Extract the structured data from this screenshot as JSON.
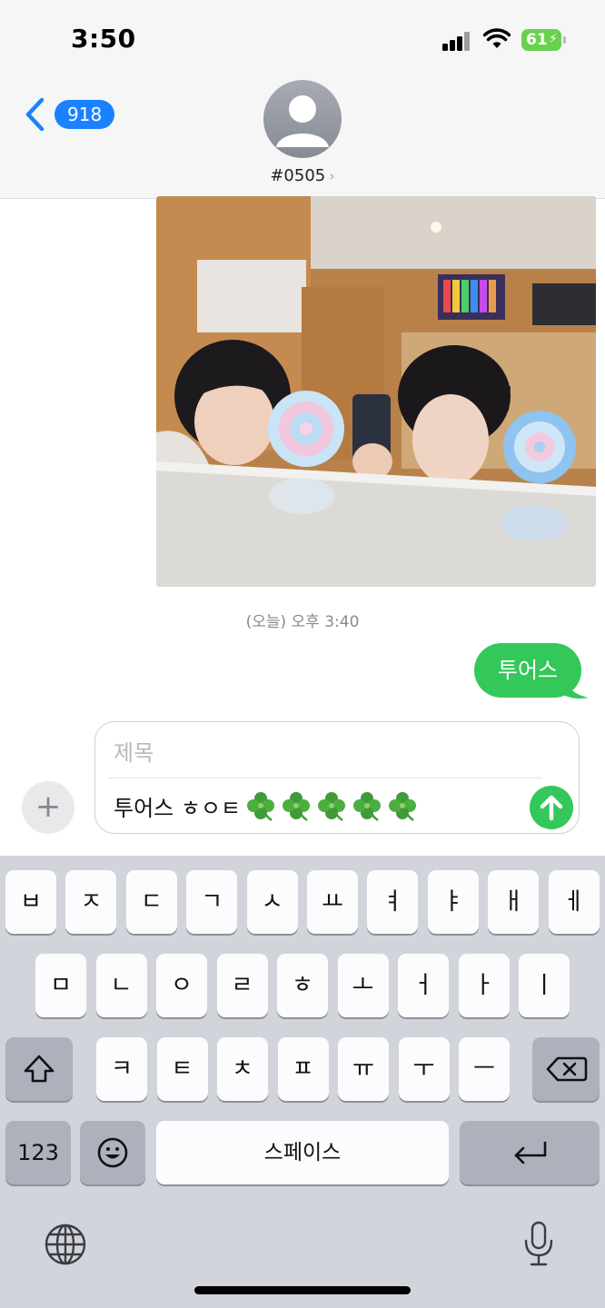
{
  "status_bar": {
    "time": "3:50",
    "battery": "61"
  },
  "header": {
    "back_count": "918",
    "contact_name": "#0505",
    "chevron": "›"
  },
  "conversation": {
    "timestamp": "(오늘) 오후 3:40",
    "sent_message": "투어스"
  },
  "compose": {
    "plus_label": "+",
    "subject_placeholder": "제목",
    "body_text": "투어스 ㅎㅇㅌ",
    "clover_count": 5
  },
  "keyboard": {
    "row1": [
      "ㅂ",
      "ㅈ",
      "ㄷ",
      "ㄱ",
      "ㅅ",
      "ㅛ",
      "ㅕ",
      "ㅑ",
      "ㅐ",
      "ㅔ"
    ],
    "row2": [
      "ㅁ",
      "ㄴ",
      "ㅇ",
      "ㄹ",
      "ㅎ",
      "ㅗ",
      "ㅓ",
      "ㅏ",
      "ㅣ"
    ],
    "row3": [
      "ㅋ",
      "ㅌ",
      "ㅊ",
      "ㅍ",
      "ㅠ",
      "ㅜ",
      "ㅡ"
    ],
    "numbers_label": "123",
    "space_label": "스페이스"
  },
  "colors": {
    "accent_blue": "#1a82ff",
    "imessage_green": "#34c759",
    "battery_green": "#6ad14f",
    "keyboard_bg": "#d2d4db"
  },
  "icons": [
    "signal-icon",
    "wifi-icon",
    "battery-icon",
    "back-chevron-icon",
    "person-icon",
    "plus-icon",
    "send-arrow-icon",
    "clover-icon",
    "shift-icon",
    "delete-icon",
    "emoji-icon",
    "return-icon",
    "globe-icon",
    "microphone-icon"
  ]
}
